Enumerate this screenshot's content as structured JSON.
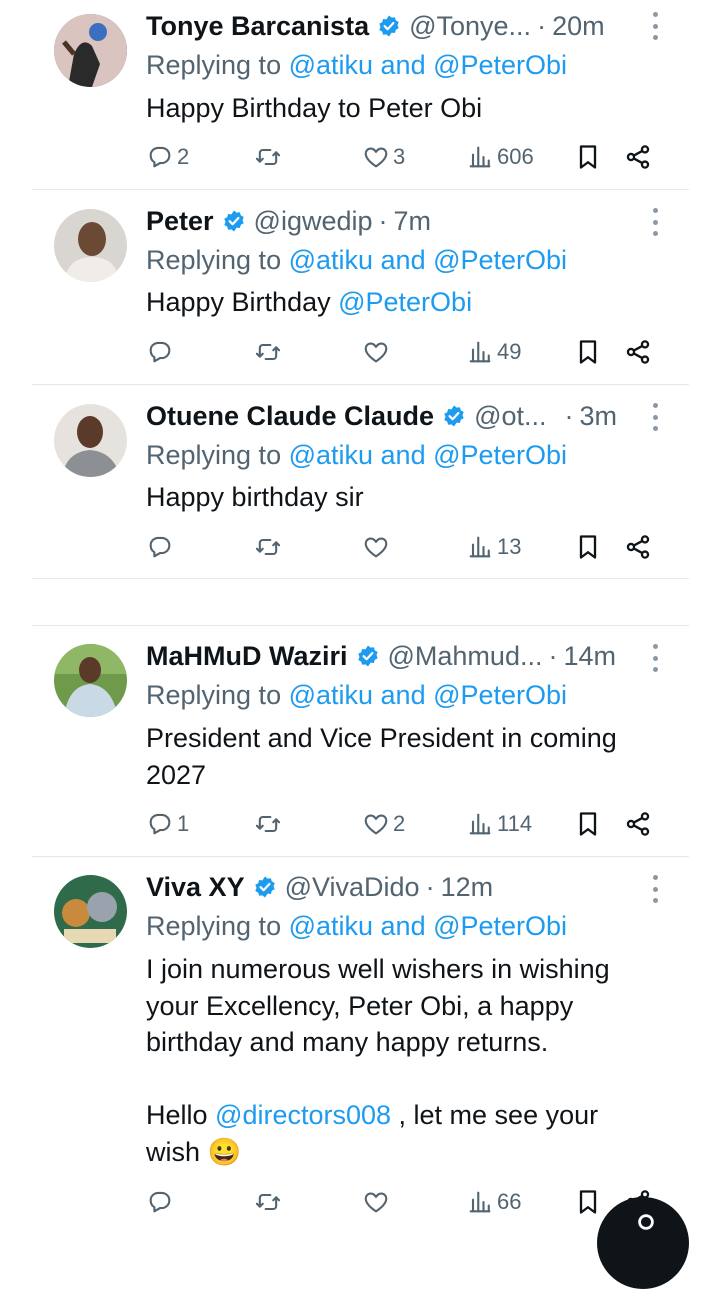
{
  "colors": {
    "link": "#1d9bf0",
    "secondary": "#536471",
    "text": "#0f1419",
    "verified": "#1d9bf0"
  },
  "tweets": [
    {
      "name": "Tonye Barcanista",
      "handle": "@Tonye...",
      "time": "20m",
      "replying_prefix": "Replying to ",
      "replying_to": "@atiku and @PeterObi",
      "body": "Happy Birthday to Peter Obi",
      "body_link": "",
      "replies": "2",
      "retweets": "",
      "likes": "3",
      "views": "606"
    },
    {
      "name": "Peter",
      "handle": "@igwedip",
      "time": "7m",
      "replying_prefix": "Replying to ",
      "replying_to": "@atiku and @PeterObi",
      "body": "Happy Birthday ",
      "body_link": "@PeterObi",
      "replies": "",
      "retweets": "",
      "likes": "",
      "views": "49"
    },
    {
      "name": "Otuene Claude Claude",
      "handle": "@ot...",
      "time": "3m",
      "replying_prefix": "Replying to ",
      "replying_to": "@atiku and @PeterObi",
      "body": "Happy birthday sir",
      "body_link": "",
      "replies": "",
      "retweets": "",
      "likes": "",
      "views": "13"
    },
    {
      "name": "MaHMuD Waziri",
      "handle": "@Mahmud...",
      "time": "14m",
      "replying_prefix": "Replying to ",
      "replying_to": "@atiku and @PeterObi",
      "body": "President and Vice President in coming 2027",
      "body_link": "",
      "replies": "1",
      "retweets": "",
      "likes": "2",
      "views": "114"
    },
    {
      "name": "Viva XY",
      "handle": "@VivaDido",
      "time": "12m",
      "replying_prefix": "Replying to ",
      "replying_to": "@atiku and @PeterObi",
      "body": "I join numerous well wishers in wishing your Excellency, Peter Obi, a happy birthday and many happy returns.",
      "body2_prefix": "Hello ",
      "body2_link": "@directors008",
      "body2_suffix": " , let me see your wish ",
      "body2_emoji": "😀",
      "replies": "",
      "retweets": "",
      "likes": "",
      "views": "66"
    }
  ],
  "icons": {
    "reply": "reply-icon",
    "retweet": "retweet-icon",
    "like": "heart-icon",
    "views": "views-icon",
    "bookmark": "bookmark-icon",
    "share": "share-icon",
    "more": "more-icon",
    "verified": "verified-badge-icon"
  }
}
